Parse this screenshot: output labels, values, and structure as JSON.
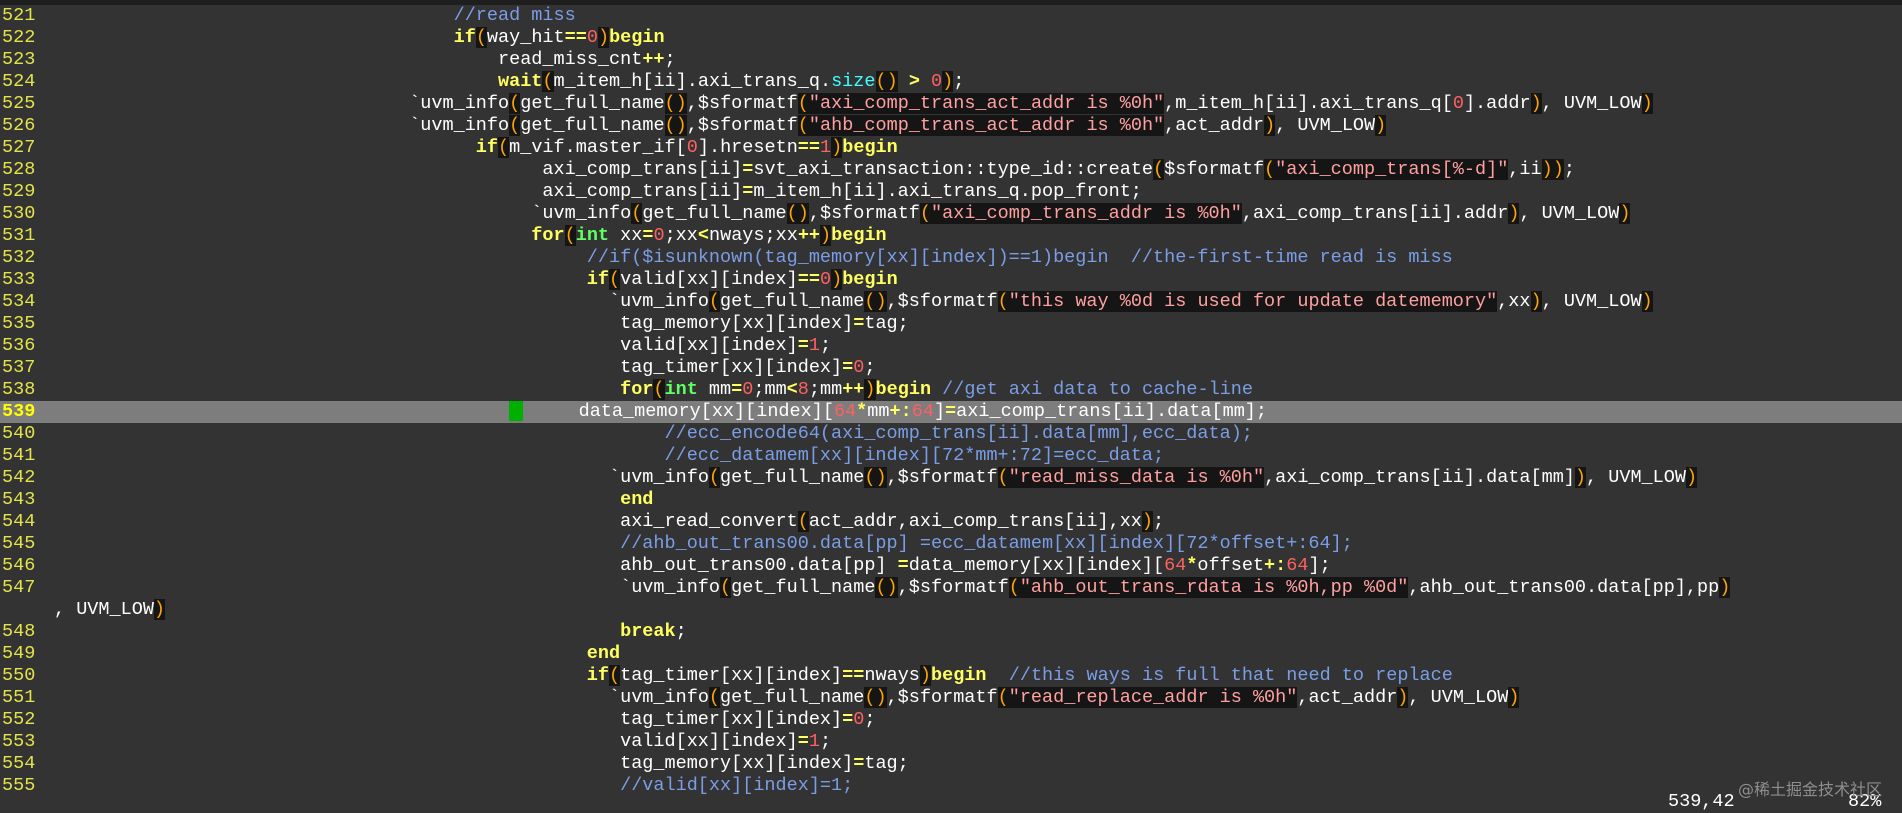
{
  "editor": {
    "lines": [
      {
        "num": "521",
        "indent": 36,
        "tokens": [
          {
            "t": "//read miss",
            "c": "cm"
          }
        ]
      },
      {
        "num": "522",
        "indent": 36,
        "tokens": [
          {
            "t": "if",
            "c": "kw"
          },
          {
            "t": "(",
            "c": "pa"
          },
          {
            "t": "way_hit"
          },
          {
            "t": "==",
            "c": "op"
          },
          {
            "t": "0",
            "c": "nu"
          },
          {
            "t": ")",
            "c": "pa"
          },
          {
            "t": "begin",
            "c": "kw"
          }
        ]
      },
      {
        "num": "523",
        "indent": 40,
        "tokens": [
          {
            "t": "read_miss_cnt"
          },
          {
            "t": "++",
            "c": "op"
          },
          {
            "t": ";"
          }
        ]
      },
      {
        "num": "524",
        "indent": 40,
        "tokens": [
          {
            "t": "wait",
            "c": "kw"
          },
          {
            "t": "(",
            "c": "pa"
          },
          {
            "t": "m_item_h[ii].axi_trans_q."
          },
          {
            "t": "size",
            "c": "fn"
          },
          {
            "t": "()",
            "c": "pa"
          },
          {
            "t": " "
          },
          {
            "t": ">",
            "c": "op"
          },
          {
            "t": " "
          },
          {
            "t": "0",
            "c": "nu"
          },
          {
            "t": ")",
            "c": "pa"
          },
          {
            "t": ";"
          }
        ]
      },
      {
        "num": "525",
        "indent": 32,
        "tokens": [
          {
            "t": "`uvm_info"
          },
          {
            "t": "(",
            "c": "pa"
          },
          {
            "t": "get_full_name"
          },
          {
            "t": "()",
            "c": "pa"
          },
          {
            "t": ",$sformatf"
          },
          {
            "t": "(",
            "c": "pa"
          },
          {
            "t": "\"axi_comp_trans_act_addr is %0h\"",
            "c": "st"
          },
          {
            "t": ",m_item_h[ii].axi_trans_q["
          },
          {
            "t": "0",
            "c": "nu"
          },
          {
            "t": "].addr"
          },
          {
            "t": ")",
            "c": "pa"
          },
          {
            "t": ", UVM_LOW"
          },
          {
            "t": ")",
            "c": "pa"
          }
        ]
      },
      {
        "num": "526",
        "indent": 32,
        "tokens": [
          {
            "t": "`uvm_info"
          },
          {
            "t": "(",
            "c": "pa"
          },
          {
            "t": "get_full_name"
          },
          {
            "t": "()",
            "c": "pa"
          },
          {
            "t": ",$sformatf"
          },
          {
            "t": "(",
            "c": "pa"
          },
          {
            "t": "\"ahb_comp_trans_act_addr is %0h\"",
            "c": "st"
          },
          {
            "t": ",act_addr"
          },
          {
            "t": ")",
            "c": "pa"
          },
          {
            "t": ", UVM_LOW"
          },
          {
            "t": ")",
            "c": "pa"
          }
        ]
      },
      {
        "num": "527",
        "indent": 38,
        "tokens": [
          {
            "t": "if",
            "c": "kw"
          },
          {
            "t": "(",
            "c": "pa"
          },
          {
            "t": "m_vif.master_if["
          },
          {
            "t": "0",
            "c": "nu"
          },
          {
            "t": "].hresetn"
          },
          {
            "t": "==",
            "c": "op"
          },
          {
            "t": "1",
            "c": "nu"
          },
          {
            "t": ")",
            "c": "pa"
          },
          {
            "t": "begin",
            "c": "kw"
          }
        ]
      },
      {
        "num": "528",
        "indent": 44,
        "tokens": [
          {
            "t": "axi_comp_trans[ii]"
          },
          {
            "t": "=",
            "c": "op"
          },
          {
            "t": "svt_axi_transaction::type_id::create"
          },
          {
            "t": "(",
            "c": "pa"
          },
          {
            "t": "$sformatf"
          },
          {
            "t": "(",
            "c": "pa"
          },
          {
            "t": "\"axi_comp_trans[%-d]\"",
            "c": "st"
          },
          {
            "t": ",ii"
          },
          {
            "t": "))",
            "c": "pa"
          },
          {
            "t": ";"
          }
        ]
      },
      {
        "num": "529",
        "indent": 44,
        "tokens": [
          {
            "t": "axi_comp_trans[ii]"
          },
          {
            "t": "=",
            "c": "op"
          },
          {
            "t": "m_item_h[ii].axi_trans_q.pop_front;"
          }
        ]
      },
      {
        "num": "530",
        "indent": 43,
        "tokens": [
          {
            "t": "`uvm_info"
          },
          {
            "t": "(",
            "c": "pa"
          },
          {
            "t": "get_full_name"
          },
          {
            "t": "()",
            "c": "pa"
          },
          {
            "t": ",$sformatf"
          },
          {
            "t": "(",
            "c": "pa"
          },
          {
            "t": "\"axi_comp_trans_addr is %0h\"",
            "c": "st"
          },
          {
            "t": ",axi_comp_trans[ii].addr"
          },
          {
            "t": ")",
            "c": "pa"
          },
          {
            "t": ", UVM_LOW"
          },
          {
            "t": ")",
            "c": "pa"
          }
        ]
      },
      {
        "num": "531",
        "indent": 43,
        "tokens": [
          {
            "t": "for",
            "c": "kw"
          },
          {
            "t": "(",
            "c": "pa"
          },
          {
            "t": "int",
            "c": "ty"
          },
          {
            "t": " xx"
          },
          {
            "t": "=",
            "c": "op"
          },
          {
            "t": "0",
            "c": "nu"
          },
          {
            "t": ";xx"
          },
          {
            "t": "<",
            "c": "op"
          },
          {
            "t": "nways;xx"
          },
          {
            "t": "++",
            "c": "op"
          },
          {
            "t": ")",
            "c": "pa"
          },
          {
            "t": "begin",
            "c": "kw"
          }
        ]
      },
      {
        "num": "532",
        "indent": 48,
        "tokens": [
          {
            "t": "//if($isunknown(tag_memory[xx][index])==1)begin  //the-first-time read is miss",
            "c": "cm"
          }
        ]
      },
      {
        "num": "533",
        "indent": 48,
        "tokens": [
          {
            "t": "if",
            "c": "kw"
          },
          {
            "t": "(",
            "c": "pa"
          },
          {
            "t": "valid[xx][index]"
          },
          {
            "t": "==",
            "c": "op"
          },
          {
            "t": "0",
            "c": "nu"
          },
          {
            "t": ")",
            "c": "pa"
          },
          {
            "t": "begin",
            "c": "kw"
          }
        ]
      },
      {
        "num": "534",
        "indent": 50,
        "tokens": [
          {
            "t": "`uvm_info"
          },
          {
            "t": "(",
            "c": "pa"
          },
          {
            "t": "get_full_name"
          },
          {
            "t": "()",
            "c": "pa"
          },
          {
            "t": ",$sformatf"
          },
          {
            "t": "(",
            "c": "pa"
          },
          {
            "t": "\"this way %0d is used for update datememory\"",
            "c": "st"
          },
          {
            "t": ",xx"
          },
          {
            "t": ")",
            "c": "pa"
          },
          {
            "t": ", UVM_LOW"
          },
          {
            "t": ")",
            "c": "pa"
          }
        ]
      },
      {
        "num": "535",
        "indent": 51,
        "tokens": [
          {
            "t": "tag_memory[xx][index]"
          },
          {
            "t": "=",
            "c": "op"
          },
          {
            "t": "tag;"
          }
        ]
      },
      {
        "num": "536",
        "indent": 51,
        "tokens": [
          {
            "t": "valid[xx][index]"
          },
          {
            "t": "=",
            "c": "op"
          },
          {
            "t": "1",
            "c": "nu"
          },
          {
            "t": ";"
          }
        ]
      },
      {
        "num": "537",
        "indent": 51,
        "tokens": [
          {
            "t": "tag_timer[xx][index]"
          },
          {
            "t": "=",
            "c": "op"
          },
          {
            "t": "0",
            "c": "nu"
          },
          {
            "t": ";"
          }
        ]
      },
      {
        "num": "538",
        "indent": 51,
        "tokens": [
          {
            "t": "for",
            "c": "kw"
          },
          {
            "t": "(",
            "c": "pa"
          },
          {
            "t": "int",
            "c": "ty"
          },
          {
            "t": " mm"
          },
          {
            "t": "=",
            "c": "op"
          },
          {
            "t": "0",
            "c": "nu"
          },
          {
            "t": ";mm"
          },
          {
            "t": "<",
            "c": "op"
          },
          {
            "t": "8",
            "c": "nu"
          },
          {
            "t": ";mm"
          },
          {
            "t": "++",
            "c": "op"
          },
          {
            "t": ")",
            "c": "pa"
          },
          {
            "t": "begin",
            "c": "kw"
          },
          {
            "t": " "
          },
          {
            "t": "//get axi data to cache-line",
            "c": "cm"
          }
        ]
      },
      {
        "num": "539",
        "indent": 41,
        "cursorline": true,
        "tokens": [
          {
            "t": "CURSOR",
            "c": "cursor"
          },
          {
            "t": "     data_memory[xx][index]["
          },
          {
            "t": "64",
            "c": "nu"
          },
          {
            "t": "*",
            "c": "op"
          },
          {
            "t": "mm"
          },
          {
            "t": "+:",
            "c": "op"
          },
          {
            "t": "64",
            "c": "nu"
          },
          {
            "t": "]"
          },
          {
            "t": "=",
            "c": "op"
          },
          {
            "t": "axi_comp_trans[ii].data[mm];"
          }
        ]
      },
      {
        "num": "540",
        "indent": 55,
        "tokens": [
          {
            "t": "//ecc_encode64(axi_comp_trans[ii].data[mm],ecc_data);",
            "c": "cm"
          }
        ]
      },
      {
        "num": "541",
        "indent": 55,
        "tokens": [
          {
            "t": "//ecc_datamem[xx][index][72*mm+:72]=ecc_data;",
            "c": "cm"
          }
        ]
      },
      {
        "num": "542",
        "indent": 50,
        "tokens": [
          {
            "t": "`uvm_info"
          },
          {
            "t": "(",
            "c": "pa"
          },
          {
            "t": "get_full_name"
          },
          {
            "t": "()",
            "c": "pa"
          },
          {
            "t": ",$sformatf"
          },
          {
            "t": "(",
            "c": "pa"
          },
          {
            "t": "\"read_miss_data is %0h\"",
            "c": "st"
          },
          {
            "t": ",axi_comp_trans[ii].data[mm]"
          },
          {
            "t": ")",
            "c": "pa"
          },
          {
            "t": ", UVM_LOW"
          },
          {
            "t": ")",
            "c": "pa"
          }
        ]
      },
      {
        "num": "543",
        "indent": 51,
        "tokens": [
          {
            "t": "end",
            "c": "kw"
          }
        ]
      },
      {
        "num": "544",
        "indent": 51,
        "tokens": [
          {
            "t": "axi_read_convert"
          },
          {
            "t": "(",
            "c": "pa"
          },
          {
            "t": "act_addr,axi_comp_trans[ii],xx"
          },
          {
            "t": ")",
            "c": "pa"
          },
          {
            "t": ";"
          }
        ]
      },
      {
        "num": "545",
        "indent": 51,
        "tokens": [
          {
            "t": "//ahb_out_trans00.data[pp] =ecc_datamem[xx][index][72*offset+:64];",
            "c": "cm"
          }
        ]
      },
      {
        "num": "546",
        "indent": 51,
        "tokens": [
          {
            "t": "ahb_out_trans00.data[pp] "
          },
          {
            "t": "=",
            "c": "op"
          },
          {
            "t": "data_memory[xx][index]["
          },
          {
            "t": "64",
            "c": "nu"
          },
          {
            "t": "*",
            "c": "op"
          },
          {
            "t": "offset"
          },
          {
            "t": "+:",
            "c": "op"
          },
          {
            "t": "64",
            "c": "nu"
          },
          {
            "t": "];"
          }
        ]
      },
      {
        "num": "547",
        "indent": 51,
        "tokens": [
          {
            "t": "`uvm_info"
          },
          {
            "t": "(",
            "c": "pa"
          },
          {
            "t": "get_full_name"
          },
          {
            "t": "()",
            "c": "pa"
          },
          {
            "t": ",$sformatf"
          },
          {
            "t": "(",
            "c": "pa"
          },
          {
            "t": "\"ahb_out_trans_rdata is %0h,pp %0d\"",
            "c": "st"
          },
          {
            "t": ",ahb_out_trans00.data[pp],pp"
          },
          {
            "t": ")",
            "c": "pa"
          }
        ]
      },
      {
        "num": "",
        "indent": 0,
        "tokens": [
          {
            "t": ", UVM_LOW"
          },
          {
            "t": ")",
            "c": "pa"
          }
        ]
      },
      {
        "num": "548",
        "indent": 51,
        "tokens": [
          {
            "t": "break",
            "c": "kw"
          },
          {
            "t": ";"
          }
        ]
      },
      {
        "num": "549",
        "indent": 48,
        "tokens": [
          {
            "t": "end",
            "c": "kw"
          }
        ]
      },
      {
        "num": "550",
        "indent": 48,
        "tokens": [
          {
            "t": "if",
            "c": "kw"
          },
          {
            "t": "(",
            "c": "pa"
          },
          {
            "t": "tag_timer[xx][index]"
          },
          {
            "t": "==",
            "c": "op"
          },
          {
            "t": "nways"
          },
          {
            "t": ")",
            "c": "pa"
          },
          {
            "t": "begin",
            "c": "kw"
          },
          {
            "t": "  "
          },
          {
            "t": "//this ways is full that need to replace",
            "c": "cm"
          }
        ]
      },
      {
        "num": "551",
        "indent": 50,
        "tokens": [
          {
            "t": "`uvm_info"
          },
          {
            "t": "(",
            "c": "pa"
          },
          {
            "t": "get_full_name"
          },
          {
            "t": "()",
            "c": "pa"
          },
          {
            "t": ",$sformatf"
          },
          {
            "t": "(",
            "c": "pa"
          },
          {
            "t": "\"read_replace_addr is %0h\"",
            "c": "st"
          },
          {
            "t": ",act_addr"
          },
          {
            "t": ")",
            "c": "pa"
          },
          {
            "t": ", UVM_LOW"
          },
          {
            "t": ")",
            "c": "pa"
          }
        ]
      },
      {
        "num": "552",
        "indent": 51,
        "tokens": [
          {
            "t": "tag_timer[xx][index]"
          },
          {
            "t": "=",
            "c": "op"
          },
          {
            "t": "0",
            "c": "nu"
          },
          {
            "t": ";"
          }
        ]
      },
      {
        "num": "553",
        "indent": 51,
        "tokens": [
          {
            "t": "valid[xx][index]"
          },
          {
            "t": "=",
            "c": "op"
          },
          {
            "t": "1",
            "c": "nu"
          },
          {
            "t": ";"
          }
        ]
      },
      {
        "num": "554",
        "indent": 51,
        "tokens": [
          {
            "t": "tag_memory[xx][index]"
          },
          {
            "t": "=",
            "c": "op"
          },
          {
            "t": "tag;"
          }
        ]
      },
      {
        "num": "555",
        "indent": 51,
        "tokens": [
          {
            "t": "//valid[xx][index]=1;",
            "c": "cm"
          }
        ]
      }
    ]
  },
  "statusbar": {
    "position": "539,42",
    "percent": "82%"
  },
  "watermark": "@稀土掘金技术社区"
}
